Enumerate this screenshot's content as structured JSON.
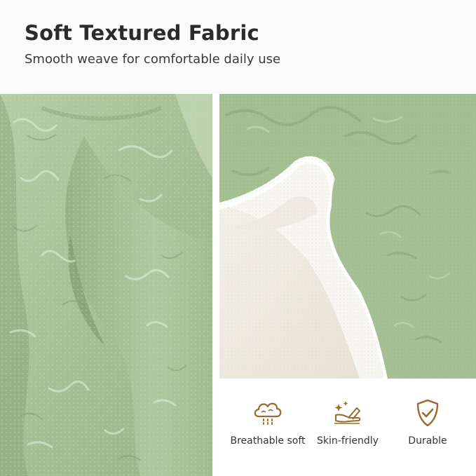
{
  "header": {
    "title": "Soft Textured Fabric",
    "subtitle": "Smooth weave for comfortable daily use"
  },
  "features": [
    {
      "label": "Breathable soft",
      "icon": "breathable-cloud-icon"
    },
    {
      "label": "Skin-friendly",
      "icon": "hand-sparkle-icon"
    },
    {
      "label": "Durable",
      "icon": "shield-check-icon"
    }
  ],
  "colors": {
    "fabric_green": "#a8c398",
    "fabric_shadow": "#7f9c72",
    "icon_gold": "#9a6a2c",
    "sherpa_white": "#f7f5ef",
    "background_cream": "#ebe7dc"
  }
}
